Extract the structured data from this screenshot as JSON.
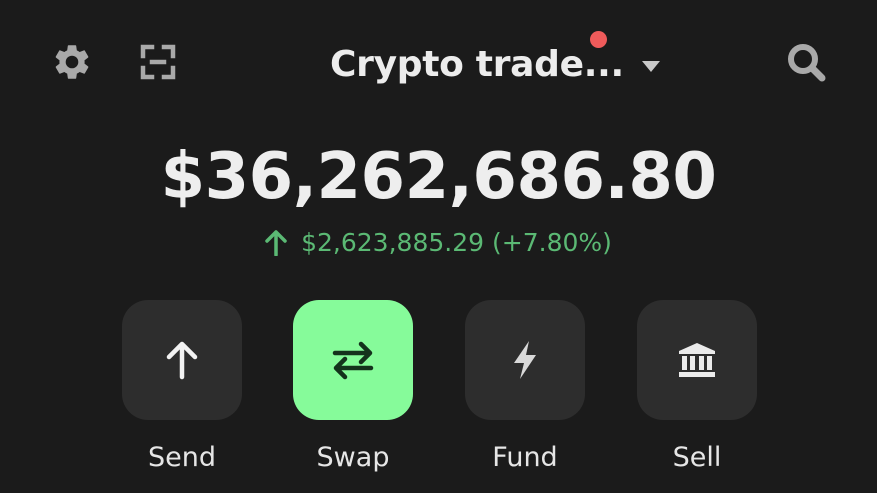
{
  "header": {
    "account_name": "Crypto trade...",
    "settings_icon": "gear-icon",
    "scan_icon": "scan-icon",
    "search_icon": "search-icon",
    "notification_color": "#ef5b5b"
  },
  "portfolio": {
    "balance": "$36,262,686.80",
    "change_amount": "$2,623,885.29",
    "change_percent": "(+7.80%)",
    "change_color": "#5bb974"
  },
  "actions": [
    {
      "label": "Send",
      "icon": "arrow-up-icon"
    },
    {
      "label": "Swap",
      "icon": "swap-arrows-icon",
      "active": true,
      "color": "#86fb9a"
    },
    {
      "label": "Fund",
      "icon": "lightning-icon"
    },
    {
      "label": "Sell",
      "icon": "bank-icon"
    }
  ]
}
